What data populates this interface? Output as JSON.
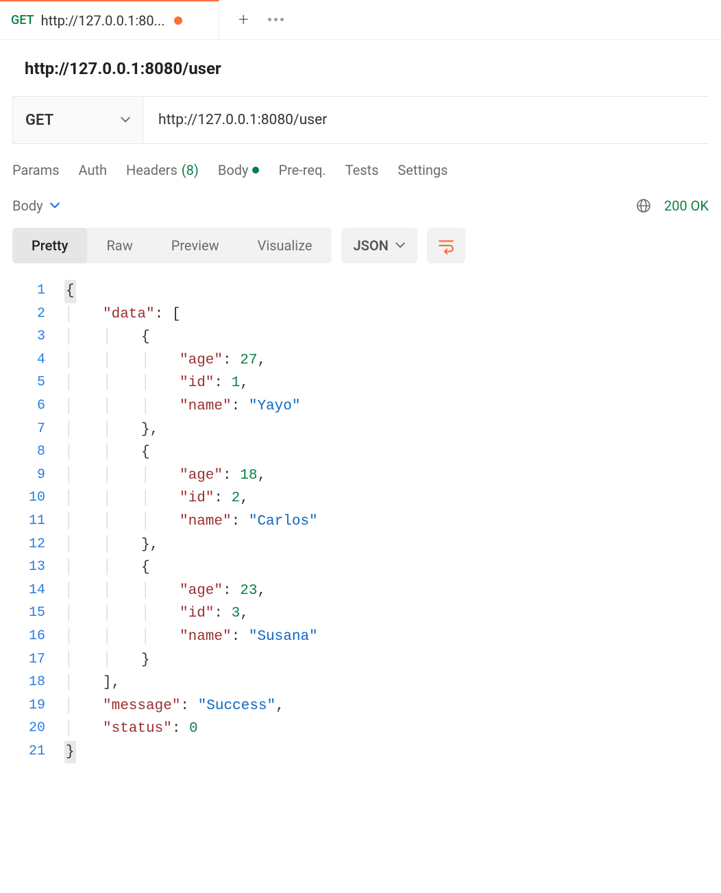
{
  "tab": {
    "method": "GET",
    "title": "http://127.0.0.1:80...",
    "unsaved": true
  },
  "request": {
    "title": "http://127.0.0.1:8080/user",
    "method": "GET",
    "url": "http://127.0.0.1:8080/user"
  },
  "reqTabs": {
    "params": "Params",
    "auth": "Auth",
    "headers": "Headers",
    "headersCount": "(8)",
    "body": "Body",
    "prereq": "Pre-req.",
    "tests": "Tests",
    "settings": "Settings"
  },
  "response": {
    "sectionLabel": "Body",
    "statusText": "200 OK",
    "views": {
      "pretty": "Pretty",
      "raw": "Raw",
      "preview": "Preview",
      "visualize": "Visualize"
    },
    "format": "JSON",
    "body": {
      "data": [
        {
          "age": 27,
          "id": 1,
          "name": "Yayo"
        },
        {
          "age": 18,
          "id": 2,
          "name": "Carlos"
        },
        {
          "age": 23,
          "id": 3,
          "name": "Susana"
        }
      ],
      "message": "Success",
      "status": 0
    }
  },
  "code": {
    "l1": "{",
    "l2_key": "\"data\"",
    "l2_rest": ": [",
    "l3": "{",
    "l4_k": "\"age\"",
    "l4_v": "27",
    "l4_c": ",",
    "l5_k": "\"id\"",
    "l5_v": "1",
    "l5_c": ",",
    "l6_k": "\"name\"",
    "l6_v": "\"Yayo\"",
    "l7": "},",
    "l8": "{",
    "l9_k": "\"age\"",
    "l9_v": "18",
    "l9_c": ",",
    "l10_k": "\"id\"",
    "l10_v": "2",
    "l10_c": ",",
    "l11_k": "\"name\"",
    "l11_v": "\"Carlos\"",
    "l12": "},",
    "l13": "{",
    "l14_k": "\"age\"",
    "l14_v": "23",
    "l14_c": ",",
    "l15_k": "\"id\"",
    "l15_v": "3",
    "l15_c": ",",
    "l16_k": "\"name\"",
    "l16_v": "\"Susana\"",
    "l17": "}",
    "l18": "],",
    "l19_k": "\"message\"",
    "l19_v": "\"Success\"",
    "l19_c": ",",
    "l20_k": "\"status\"",
    "l20_v": "0",
    "l21": "}"
  },
  "lineNumbers": [
    "1",
    "2",
    "3",
    "4",
    "5",
    "6",
    "7",
    "8",
    "9",
    "10",
    "11",
    "12",
    "13",
    "14",
    "15",
    "16",
    "17",
    "18",
    "19",
    "20",
    "21"
  ]
}
